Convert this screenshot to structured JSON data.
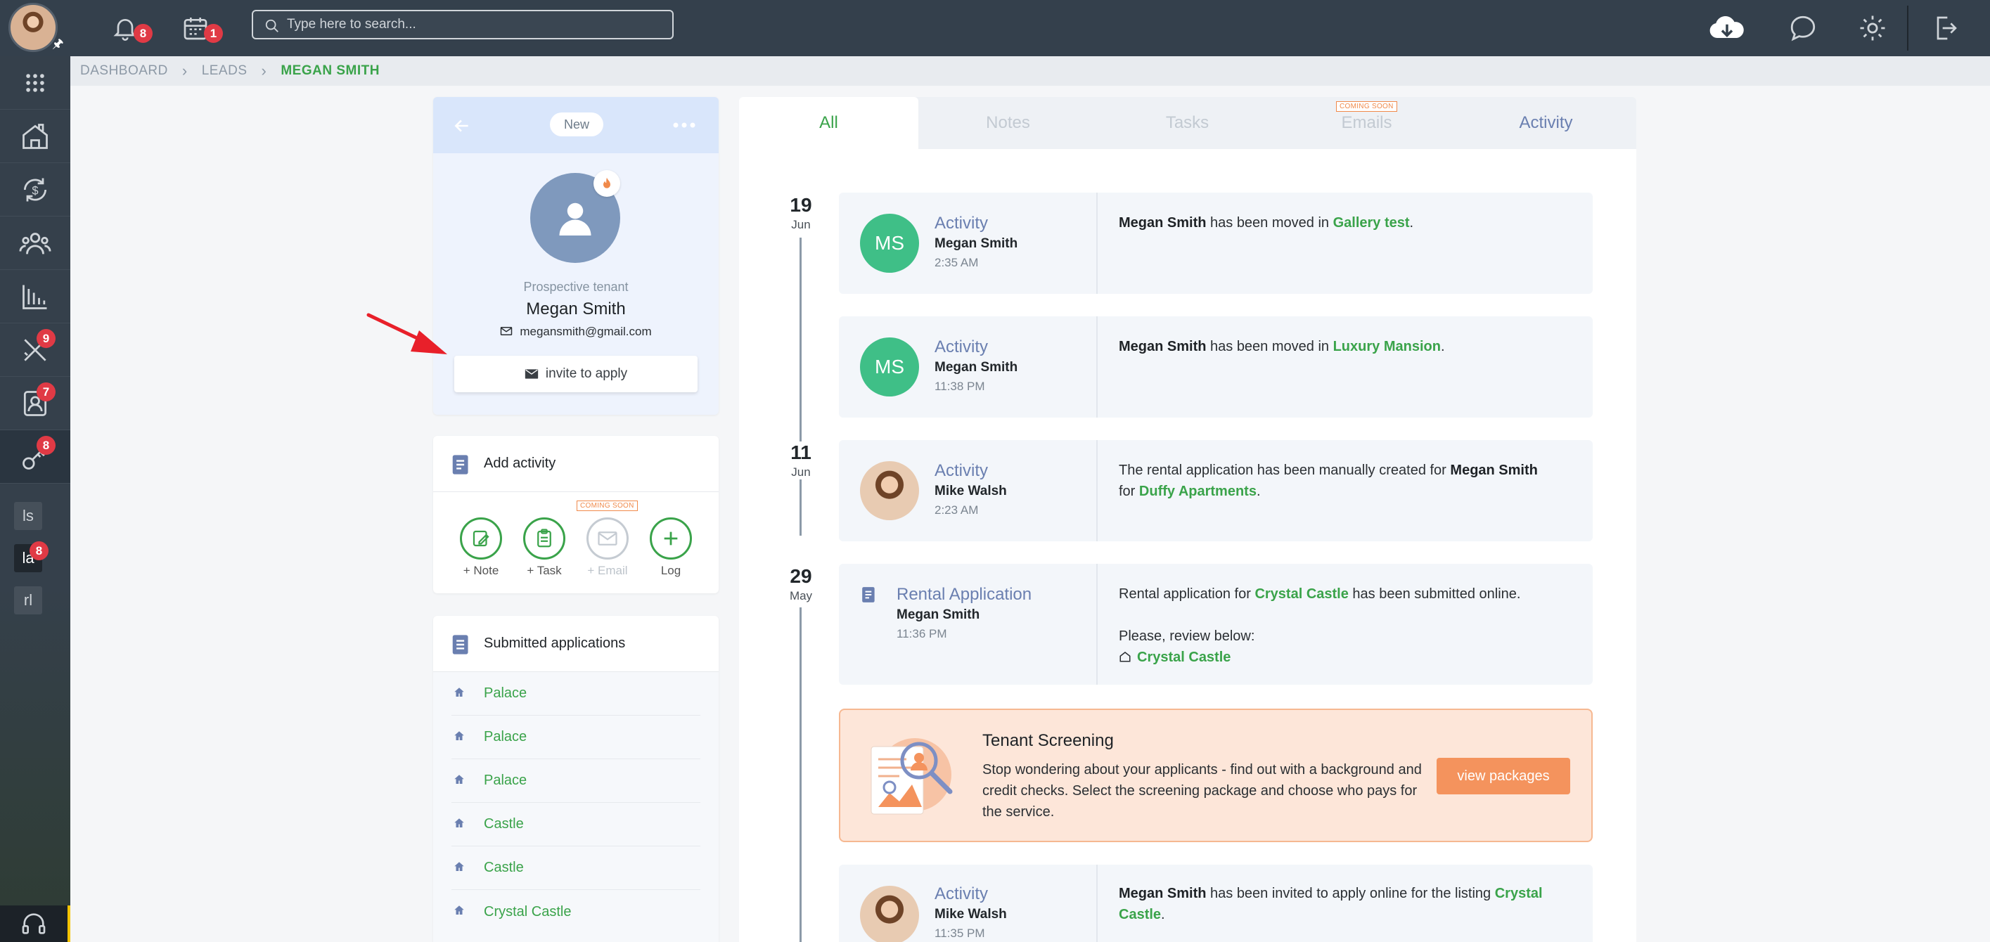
{
  "topbar": {
    "notifications_badge": "8",
    "calendar_badge": "1",
    "search_placeholder": "Type here to search..."
  },
  "breadcrumb": {
    "items": [
      "DASHBOARD",
      "LEADS"
    ],
    "current": "MEGAN SMITH"
  },
  "sidebar": {
    "badges": {
      "tools": "9",
      "contacts": "7",
      "keys": "8",
      "la": "8"
    },
    "small_items": [
      "ls",
      "la",
      "rl"
    ]
  },
  "profile": {
    "status": "New",
    "role": "Prospective tenant",
    "name": "Megan Smith",
    "email": "megansmith@gmail.com",
    "invite_label": "invite to apply"
  },
  "add_activity": {
    "title": "Add activity",
    "coming_soon": "COMING SOON",
    "actions": [
      {
        "label": "+ Note"
      },
      {
        "label": "+ Task"
      },
      {
        "label": "+ Email"
      },
      {
        "label": "Log"
      }
    ]
  },
  "submitted": {
    "title": "Submitted applications",
    "items": [
      "Palace",
      "Palace",
      "Palace",
      "Castle",
      "Castle",
      "Crystal Castle"
    ]
  },
  "tabs": {
    "all": "All",
    "notes": "Notes",
    "tasks": "Tasks",
    "emails": "Emails",
    "emails_tag": "COMING SOON",
    "activity": "Activity"
  },
  "timeline": {
    "dates": [
      {
        "day": "19",
        "month": "Jun"
      },
      {
        "day": "11",
        "month": "Jun"
      },
      {
        "day": "29",
        "month": "May"
      }
    ],
    "entries": [
      {
        "initials": "MS",
        "type": "Activity",
        "who": "Megan Smith",
        "time": "2:35 AM",
        "t1": "Megan Smith",
        "t2": " has been moved in ",
        "t3": "Gallery test",
        "t4": "."
      },
      {
        "initials": "MS",
        "type": "Activity",
        "who": "Megan Smith",
        "time": "11:38 PM",
        "t1": "Megan Smith",
        "t2": " has been moved in ",
        "t3": "Luxury Mansion",
        "t4": "."
      },
      {
        "type": "Activity",
        "who": "Mike Walsh",
        "time": "2:23 AM",
        "t1": "The rental application has been manually created for ",
        "t2": "Megan Smith",
        "t3": " for ",
        "t4": "Duffy Apartments",
        "t5": "."
      },
      {
        "type": "Rental Application",
        "who": "Megan Smith",
        "time": "11:36 PM",
        "t1": "Rental application for ",
        "t2": "Crystal Castle",
        "t3": " has been submitted online.",
        "t4": "Please, review below:",
        "t5": "Crystal Castle"
      },
      {
        "type": "Activity",
        "who": "Mike Walsh",
        "time": "11:35 PM",
        "t1": "Megan Smith",
        "t2": " has been invited to apply online for the listing ",
        "t3": "Crystal Castle",
        "t4": "."
      }
    ],
    "screening": {
      "title": "Tenant Screening",
      "body": "Stop wondering about your applicants - find out with a background and credit checks. Select the screening package and choose who pays for the service.",
      "button": "view packages"
    }
  }
}
